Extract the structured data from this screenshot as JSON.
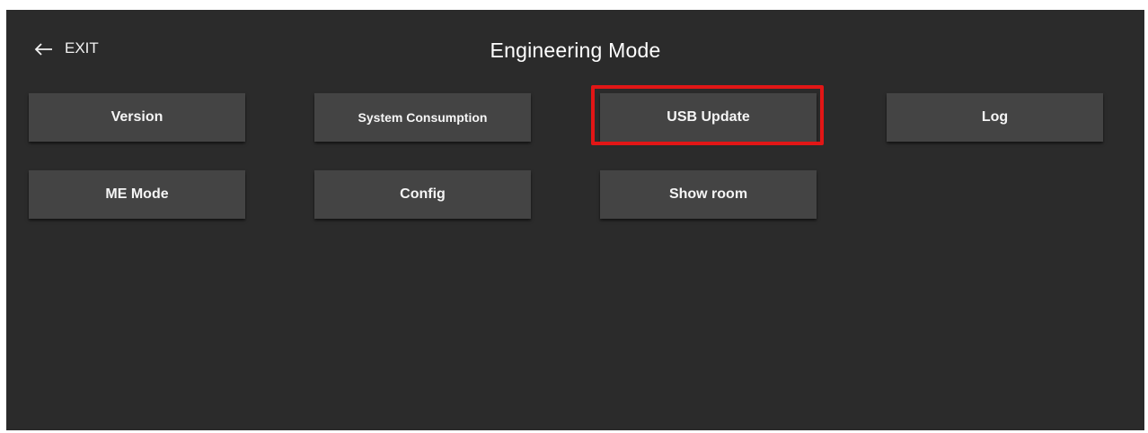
{
  "header": {
    "exit_label": "EXIT",
    "exit_icon": "arrow-left-icon",
    "title": "Engineering Mode"
  },
  "buttons": {
    "version": "Version",
    "system_consumption": "System Consumption",
    "usb_update": "USB Update",
    "log": "Log",
    "me_mode": "ME Mode",
    "config": "Config",
    "show_room": "Show room"
  },
  "colors": {
    "background": "#2b2b2b",
    "button": "#444444",
    "highlight": "#e21616",
    "text": "#ffffff"
  }
}
